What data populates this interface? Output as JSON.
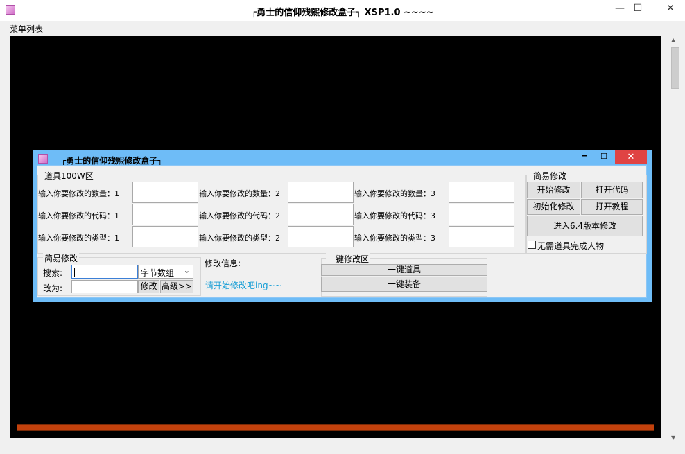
{
  "window": {
    "title": "┍勇士的信仰残熙修改盒子┑  XSP1.0 ~~~~",
    "minimize": "—",
    "maximize": "☐",
    "close": "✕"
  },
  "menu": {
    "item": "菜单列表"
  },
  "dialog": {
    "title": "┍勇士的信仰残熙修改盒子┑",
    "minimize": "━",
    "maximize": "☐",
    "close": "✕",
    "items_group": {
      "legend": "道具100W区",
      "columns": [
        {
          "qty": "输入你要修改的数量：1",
          "code": "输入你要修改的代码：1",
          "type": "输入你要修改的类型：1"
        },
        {
          "qty": "输入你要修改的数量：2",
          "code": "输入你要修改的代码：2",
          "type": "输入你要修改的类型：2"
        },
        {
          "qty": "输入你要修改的数量：3",
          "code": "输入你要修改的代码：3",
          "type": "输入你要修改的类型：3"
        }
      ]
    },
    "simple_group_right": {
      "legend": "简易修改",
      "start": "开始修改",
      "open_code": "打开代码",
      "init": "初始化修改",
      "open_tutorial": "打开教程",
      "enter_v64": "进入6.4版本修改",
      "no_item_checkbox": "无需道具完成人物"
    },
    "simple_group_left": {
      "legend": "简易修改",
      "search_label": "搜索:",
      "search_value": "",
      "type_select": "字节数组",
      "change_label": "改为:",
      "change_value": "",
      "modify": "修改",
      "advanced": "高级>>"
    },
    "info": {
      "label": "修改信息:",
      "text": "请开始修改吧ing~~"
    },
    "onekey": {
      "legend": "一键修改区",
      "items": "一键道具",
      "equip": "一键装备"
    }
  }
}
